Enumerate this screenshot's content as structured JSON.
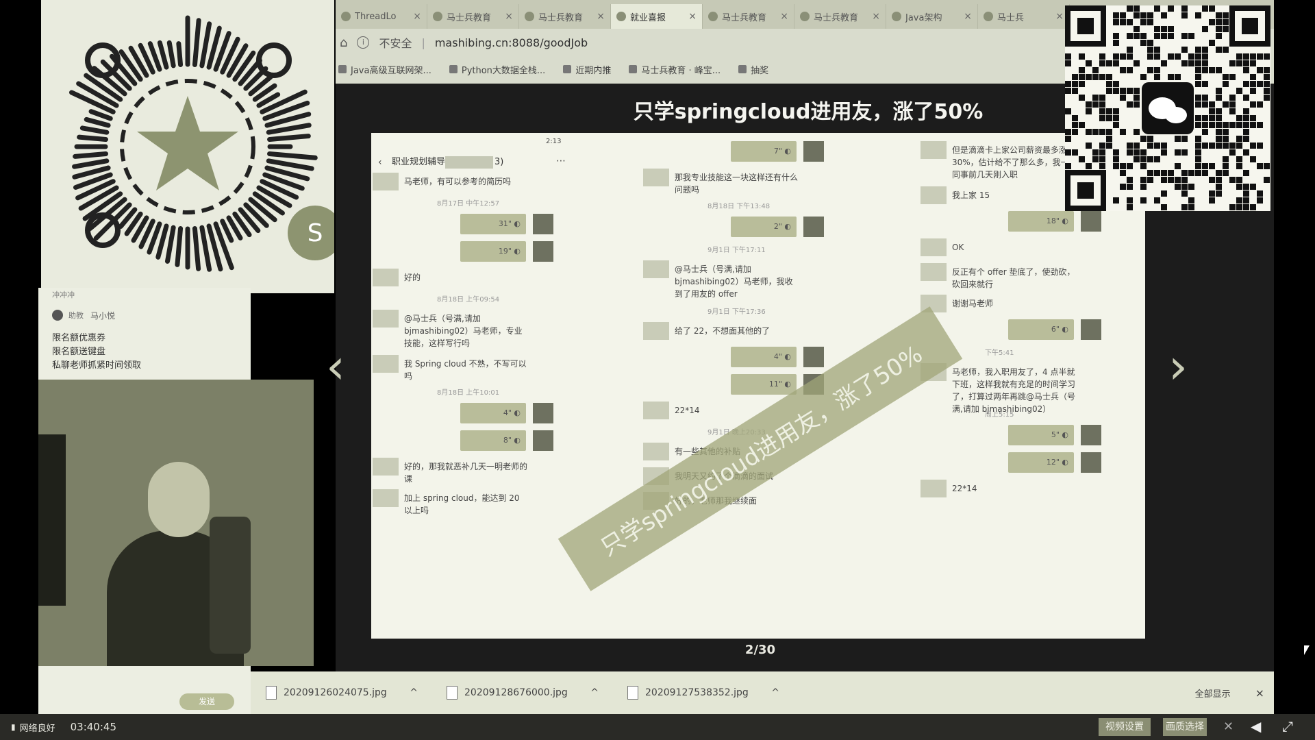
{
  "browser": {
    "tabs": [
      {
        "label": "ThreadLo",
        "active": false
      },
      {
        "label": "马士兵教育",
        "active": false
      },
      {
        "label": "马士兵教育",
        "active": false
      },
      {
        "label": "就业喜报",
        "active": true
      },
      {
        "label": "马士兵教育",
        "active": false
      },
      {
        "label": "马士兵教育",
        "active": false
      },
      {
        "label": "Java架构",
        "active": false
      },
      {
        "label": "马士兵",
        "active": false
      }
    ],
    "tab_close": "×",
    "security_label": "不安全",
    "url": "mashibing.cn:8088/goodJob",
    "bookmarks": [
      "Java高级互联网架...",
      "Python大数据全栈...",
      "近期内推",
      "马士兵教育 · 峰宝...",
      "抽奖"
    ]
  },
  "slide": {
    "title": "只学springcloud进用友，涨了50%",
    "watermark": "只学springcloud进用友，涨了50%",
    "counter": "2/30",
    "prev_arrow": "‹",
    "next_arrow": "›"
  },
  "chat_left": {
    "header": "职业规划辅导",
    "header_suffix": "3)",
    "status_time": "2:13",
    "messages": [
      {
        "kind": "text",
        "text": "马老师，有可以参考的简历吗"
      },
      {
        "kind": "time",
        "text": "8月17日 中午12:57"
      },
      {
        "kind": "voice",
        "text": "31\""
      },
      {
        "kind": "voice",
        "text": "19\""
      },
      {
        "kind": "text",
        "text": "好的"
      },
      {
        "kind": "time",
        "text": "8月18日 上午09:54"
      },
      {
        "kind": "text",
        "text": "@马士兵（号满,请加 bjmashibing02）马老师，专业技能，这样写行吗"
      },
      {
        "kind": "text",
        "text": "我 Spring cloud 不熟，不写可以吗"
      },
      {
        "kind": "time",
        "text": "8月18日 上午10:01"
      },
      {
        "kind": "voice",
        "text": "4\""
      },
      {
        "kind": "voice",
        "text": "8\""
      },
      {
        "kind": "text",
        "text": "好的，那我就恶补几天一明老师的课"
      },
      {
        "kind": "text",
        "text": "加上 spring cloud，能达到 20 以上吗"
      }
    ]
  },
  "chat_mid": {
    "messages": [
      {
        "kind": "voice",
        "text": "7\""
      },
      {
        "kind": "text",
        "text": "那我专业技能这一块这样还有什么问题吗"
      },
      {
        "kind": "time",
        "text": "8月18日 下午13:48"
      },
      {
        "kind": "voice",
        "text": "2\""
      },
      {
        "kind": "time",
        "text": "9月1日 下午17:11"
      },
      {
        "kind": "text",
        "text": "@马士兵（号满,请加 bjmashibing02）马老师，我收到了用友的 offer"
      },
      {
        "kind": "time",
        "text": "9月1日 下午17:36"
      },
      {
        "kind": "text",
        "text": "给了 22，不想面其他的了"
      },
      {
        "kind": "voice",
        "text": "4\""
      },
      {
        "kind": "voice",
        "text": "11\""
      },
      {
        "kind": "text",
        "text": "22*14"
      },
      {
        "kind": "time",
        "text": "9月1日 晚上20:33"
      },
      {
        "kind": "text",
        "text": "有一些其他的补贴"
      },
      {
        "kind": "text",
        "text": "我明天又约了个滴滴的面试"
      },
      {
        "kind": "text",
        "text": "好的，老师那我继续面"
      }
    ]
  },
  "chat_right": {
    "messages": [
      {
        "kind": "text",
        "text": "但是滴滴卡上家公司薪资最多涨幅 30%，估计给不了那么多，我一同事前几天刚入职"
      },
      {
        "kind": "text",
        "text": "我上家 15"
      },
      {
        "kind": "voice",
        "text": "18\""
      },
      {
        "kind": "text",
        "text": "OK"
      },
      {
        "kind": "text",
        "text": "反正有个 offer 垫底了，使劲砍，砍回来就行"
      },
      {
        "kind": "text",
        "text": "谢谢马老师"
      },
      {
        "kind": "voice",
        "text": "6\""
      },
      {
        "kind": "time",
        "text": "下午5:41"
      },
      {
        "kind": "text",
        "text": "马老师，我入职用友了，4 点半就下班，这样我就有充足的时间学习了，打算过两年再跳@马士兵（号满,请加 bjmashibing02）"
      },
      {
        "kind": "time",
        "text": "周上5:15"
      },
      {
        "kind": "voice",
        "text": "5\""
      },
      {
        "kind": "voice",
        "text": "12\""
      },
      {
        "kind": "text",
        "text": "22*14"
      }
    ]
  },
  "left_panel": {
    "header_cut": "冲冲冲",
    "sender_role": "助教",
    "sender_name": "马小悦",
    "lines": [
      "限名额优惠券",
      "限名额送键盘",
      "私聊老师抓紧时间领取"
    ],
    "send_button": "发送"
  },
  "downloads": {
    "files": [
      "20209126024075.jpg",
      "20209128676000.jpg",
      "20209127538352.jpg"
    ],
    "chevron": "^",
    "show_all": "全部显示",
    "close": "×"
  },
  "taskbar": {
    "network": "网络良好",
    "time": "03:40:45",
    "buttons": [
      "视频设置",
      "画质选择"
    ]
  }
}
